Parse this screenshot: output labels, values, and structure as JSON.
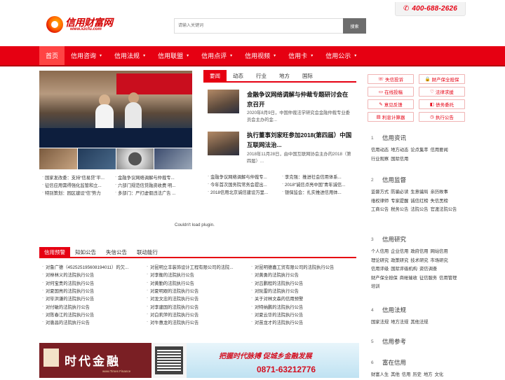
{
  "header": {
    "phone": "400-688-2626",
    "logo_text": "信用财富网",
    "logo_url": "www.xzcfu.com",
    "search_placeholder": "请输入关键词",
    "search_button": "搜索"
  },
  "nav": {
    "items": [
      {
        "label": "首页",
        "active": true,
        "caret": ""
      },
      {
        "label": "信用咨询",
        "caret": "▾"
      },
      {
        "label": "信用法规",
        "caret": "▾"
      },
      {
        "label": "信用联盟",
        "caret": "▾"
      },
      {
        "label": "信用点评",
        "caret": "▾"
      },
      {
        "label": "信用视频",
        "caret": "▾"
      },
      {
        "label": "信用卡",
        "caret": "▾"
      },
      {
        "label": "信用公示",
        "caret": "▾"
      }
    ]
  },
  "slider_captions": [
    [
      "国家发改委：支持“信易贷”平...",
      "金融争议网络调解与仲裁专..."
    ],
    [
      "征信应用需得强化监管和立...",
      "六部门规范信贷融资收费 明..."
    ],
    [
      "特别策划：园区建设“信”势力",
      "多部门：严打虚假违法广告 ..."
    ]
  ],
  "news_tabs": [
    "要闻",
    "动态",
    "行业",
    "地方",
    "国际"
  ],
  "news_items": [
    {
      "title": "金融争议网络调解与仲裁专题研讨会在京召开",
      "desc": "2020年8月9日，中国仲裁法学研究会金融仲裁专业委员会主办的金..."
    },
    {
      "title": "执行董事刘家旺参加2018(第四届）中国互联网法治...",
      "desc": "2018年11月28日，由中国互联网协会主办的2018（第四届）..."
    }
  ],
  "news_list": [
    [
      "金融争议网络调解与仲裁专...",
      "李克强：推进社会信用体系..."
    ],
    [
      "今年首次国务院常务会提出...",
      "2018“诚信点亮中国”青年诚信..."
    ],
    [
      "2018信用北京诚信建设万里...",
      "银保监会：扎实推进信用体..."
    ]
  ],
  "plugin_msg": "Couldn't load plugin.",
  "bottom_tabs": [
    "信用预警",
    "知如公告",
    "失信公告",
    "联动能行"
  ],
  "bottom_list": [
    [
      "对鲁广德（452525195608194011）的欠...",
      "对昆明立丰装饰设计工程有限公司的法院...",
      "对昆明德嘉工贸有限公司的法院执行公告"
    ],
    [
      "对林林义的法院执行公告",
      "对李衡的法院执行公告",
      "对黄勇的法院执行公告"
    ],
    [
      "对何宝贵的法院执行公告",
      "对黄勤的法院执行公告",
      "对吕鹏程的法院执行公告"
    ],
    [
      "对夏国亮的法院执行公告",
      "对夏明艰的法院执行公告",
      "对阮雷的法院执行公告"
    ],
    [
      "对毕洪谦的法院执行公告",
      "对龙文忠的法院执行公告",
      "关于对林文森的信用预警"
    ],
    [
      "对付敏的法院执行公告",
      "对李建国的法院执行公告",
      "对特纳鹏的法院执行公告"
    ],
    [
      "对陈春江的法院执行公告",
      "对白莉萍的法院执行公告",
      "对夏云华的法院执行公告"
    ],
    [
      "对唐昌的法院执行公告",
      "对牛惠龙的法院执行公告",
      "对苗龙才的法院执行公告"
    ]
  ],
  "ad": {
    "left_text": "时代金融",
    "left_sub": "www.Times Finance",
    "right_slogan": "把握时代脉搏 促城乡金融发展",
    "right_phone": "0871-63212776"
  },
  "side_buttons": [
    {
      "icon": "☏",
      "label": "失信投诉"
    },
    {
      "icon": "🔒",
      "label": "财产保全担保"
    },
    {
      "icon": "▭",
      "label": "在线投稿"
    },
    {
      "icon": "♡",
      "label": "法律求援"
    },
    {
      "icon": "✎",
      "label": "意见反馈"
    },
    {
      "icon": "◧",
      "label": "债务委托"
    },
    {
      "icon": "▤",
      "label": "利息计算器"
    },
    {
      "icon": "◷",
      "label": "执行公告"
    }
  ],
  "side_cats": [
    {
      "no": "1",
      "title": "信用资讯",
      "items": [
        "信用动态",
        "地方动态",
        "论点集萃",
        "信用要闻",
        "行业观察",
        "国际信用"
      ]
    },
    {
      "no": "2",
      "title": "信用监督",
      "items": [
        "监督方式",
        "防骗必读",
        "生意骗局",
        "亲历故事",
        "维权律师",
        "专家提醒",
        "诚信红榜",
        "失信黑榜",
        "工商公告",
        "税务公告",
        "法院公告",
        "官渡法院公告"
      ]
    },
    {
      "no": "3",
      "title": "信用研究",
      "items": [
        "个人信用",
        "企业信用",
        "政府信用",
        "网站信用",
        "理论研究",
        "政策研究",
        "技术研究",
        "市场研究",
        "信用评级",
        "国际评级机构",
        "资信调查",
        "财产保全担保",
        "商帐催收",
        "征信服务",
        "信用管理",
        "培训"
      ]
    },
    {
      "no": "4",
      "title": "信用法规",
      "items": [
        "国家法规",
        "地方法规",
        "其他法规"
      ]
    },
    {
      "no": "5",
      "title": "信用参考",
      "items": []
    },
    {
      "no": "6",
      "title": "富在信用",
      "items": [
        "财富人生",
        "其他",
        "信用",
        "历史",
        "地方",
        "文化"
      ]
    }
  ]
}
